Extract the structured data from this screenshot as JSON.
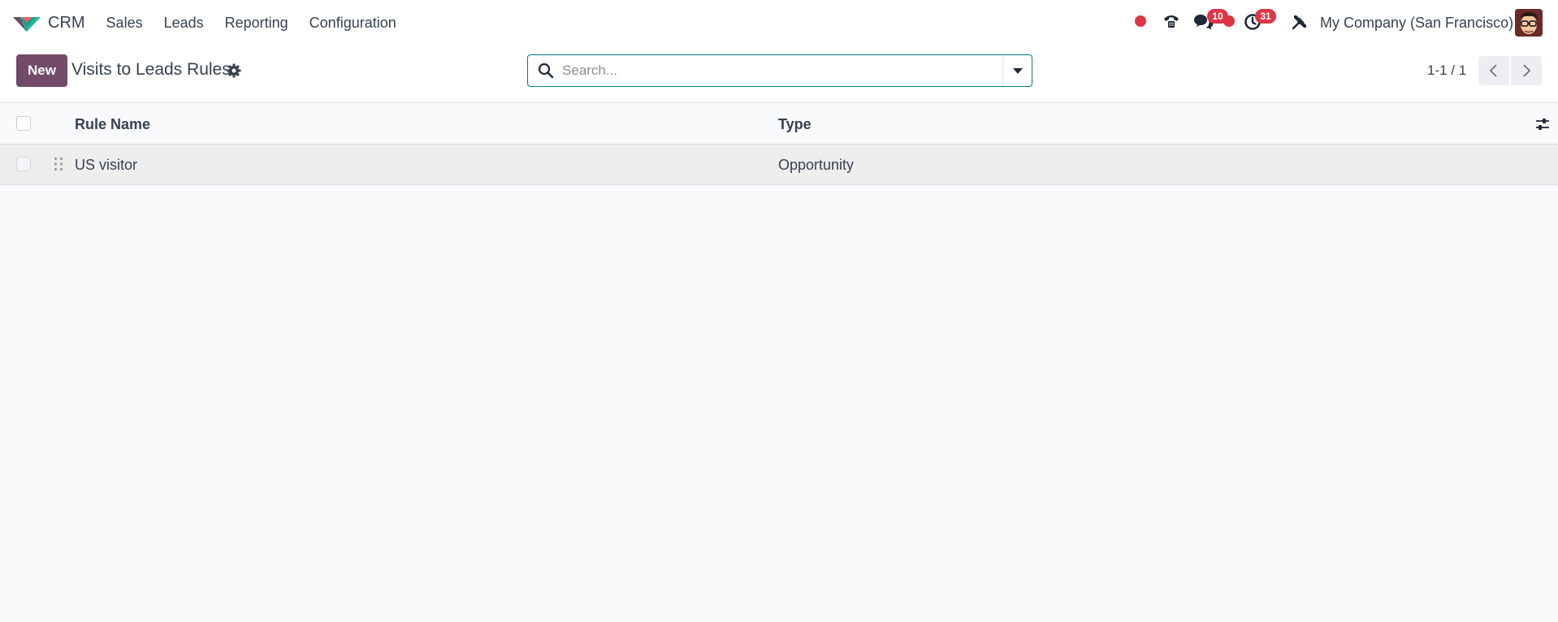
{
  "app": {
    "name": "CRM",
    "brand_colors": {
      "primary": "#714b67",
      "teal": "#21b799",
      "pink": "#e4626b"
    }
  },
  "menu": [
    {
      "label": "Sales"
    },
    {
      "label": "Leads"
    },
    {
      "label": "Reporting"
    },
    {
      "label": "Configuration"
    }
  ],
  "systray": {
    "recording_color": "#dc3545",
    "phone_icon": "phone-icon",
    "messages_icon": "chat-icon",
    "messages_count": "10",
    "activities_icon": "clock-icon",
    "activities_count": "31",
    "debug_icon": "tools-icon",
    "company": "My Company (San Francisco)"
  },
  "control_panel": {
    "new_label": "New",
    "title": "Visits to Leads Rules",
    "settings_icon": "gear-icon",
    "search_placeholder": "Search...",
    "pager": "1-1 / 1"
  },
  "list": {
    "columns": [
      {
        "label": "Rule Name"
      },
      {
        "label": "Type"
      }
    ],
    "rows": [
      {
        "rule_name": "US visitor",
        "type": "Opportunity"
      }
    ]
  },
  "colors": {
    "background": "#f9fafb",
    "accent": "#714b67",
    "search_border": "#017e84",
    "badge": "#dc3545",
    "selected_row": "#eeeeee"
  }
}
